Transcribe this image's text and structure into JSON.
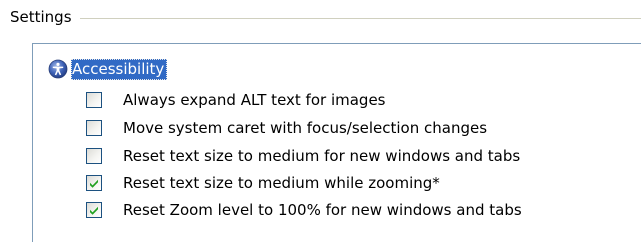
{
  "settings": {
    "title": "Settings"
  },
  "tree": {
    "category": {
      "label": "Accessibility",
      "icon": "accessibility-icon",
      "selected": true
    },
    "options": [
      {
        "label": "Always expand ALT text for images",
        "checked": false
      },
      {
        "label": "Move system caret with focus/selection changes",
        "checked": false
      },
      {
        "label": "Reset text size to medium for new windows and tabs",
        "checked": false
      },
      {
        "label": "Reset text size to medium while zooming*",
        "checked": true
      },
      {
        "label": "Reset Zoom level to 100% for new windows and tabs",
        "checked": true
      }
    ]
  },
  "colors": {
    "selection": "#316ac5",
    "checkbox_border": "#1c5180",
    "check_mark": "#21a121",
    "panel_border": "#7f9db9",
    "group_rule": "#d0d0bf"
  }
}
